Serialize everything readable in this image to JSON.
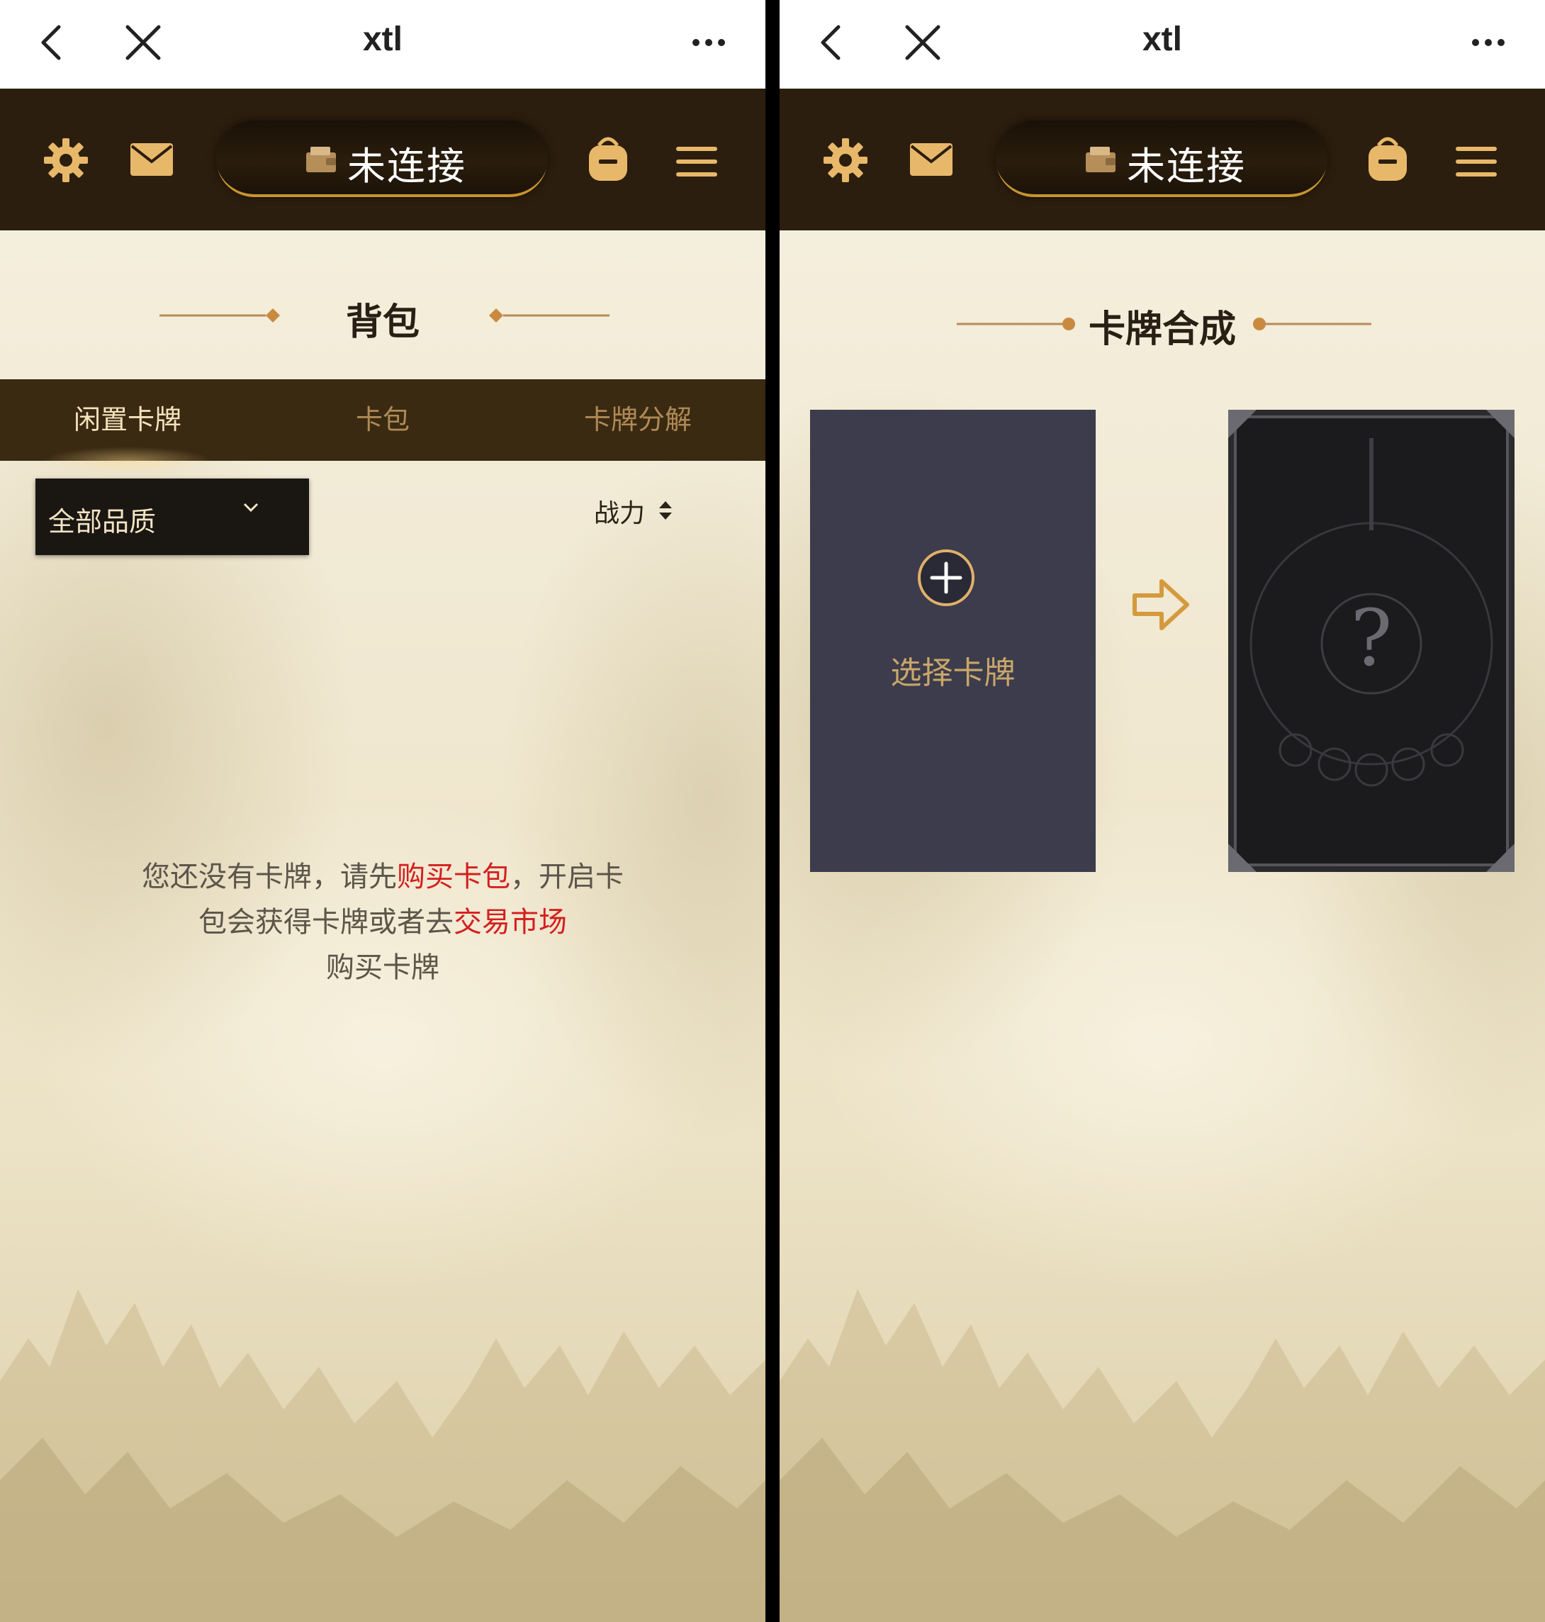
{
  "left": {
    "topbar": {
      "title": "xtl"
    },
    "gamebar": {
      "status": "未连接"
    },
    "section_title": "背包",
    "tabs": [
      {
        "label": "闲置卡牌",
        "active": true
      },
      {
        "label": "卡包",
        "active": false
      },
      {
        "label": "卡牌分解",
        "active": false
      }
    ],
    "quality_filter": {
      "selected": "全部品质"
    },
    "sort": {
      "label": "战力"
    },
    "empty_message": {
      "part1": "您还没有卡牌，请先",
      "link1": "购买卡包",
      "part2": "，开启卡包会获得卡牌或者去",
      "link2": "交易市场",
      "part3": "购买卡牌"
    }
  },
  "right": {
    "topbar": {
      "title": "xtl"
    },
    "gamebar": {
      "status": "未连接"
    },
    "section_title": "卡牌合成",
    "select_card": {
      "label": "选择卡牌"
    },
    "result_card": {
      "mystery": "?"
    }
  },
  "colors": {
    "header_bg": "#2c1e0e",
    "tab_bar_bg": "#3a2a12",
    "gold_accent": "#c8942f",
    "link_red": "#d41f1f",
    "card_slot_bg": "#3c3c4c"
  }
}
